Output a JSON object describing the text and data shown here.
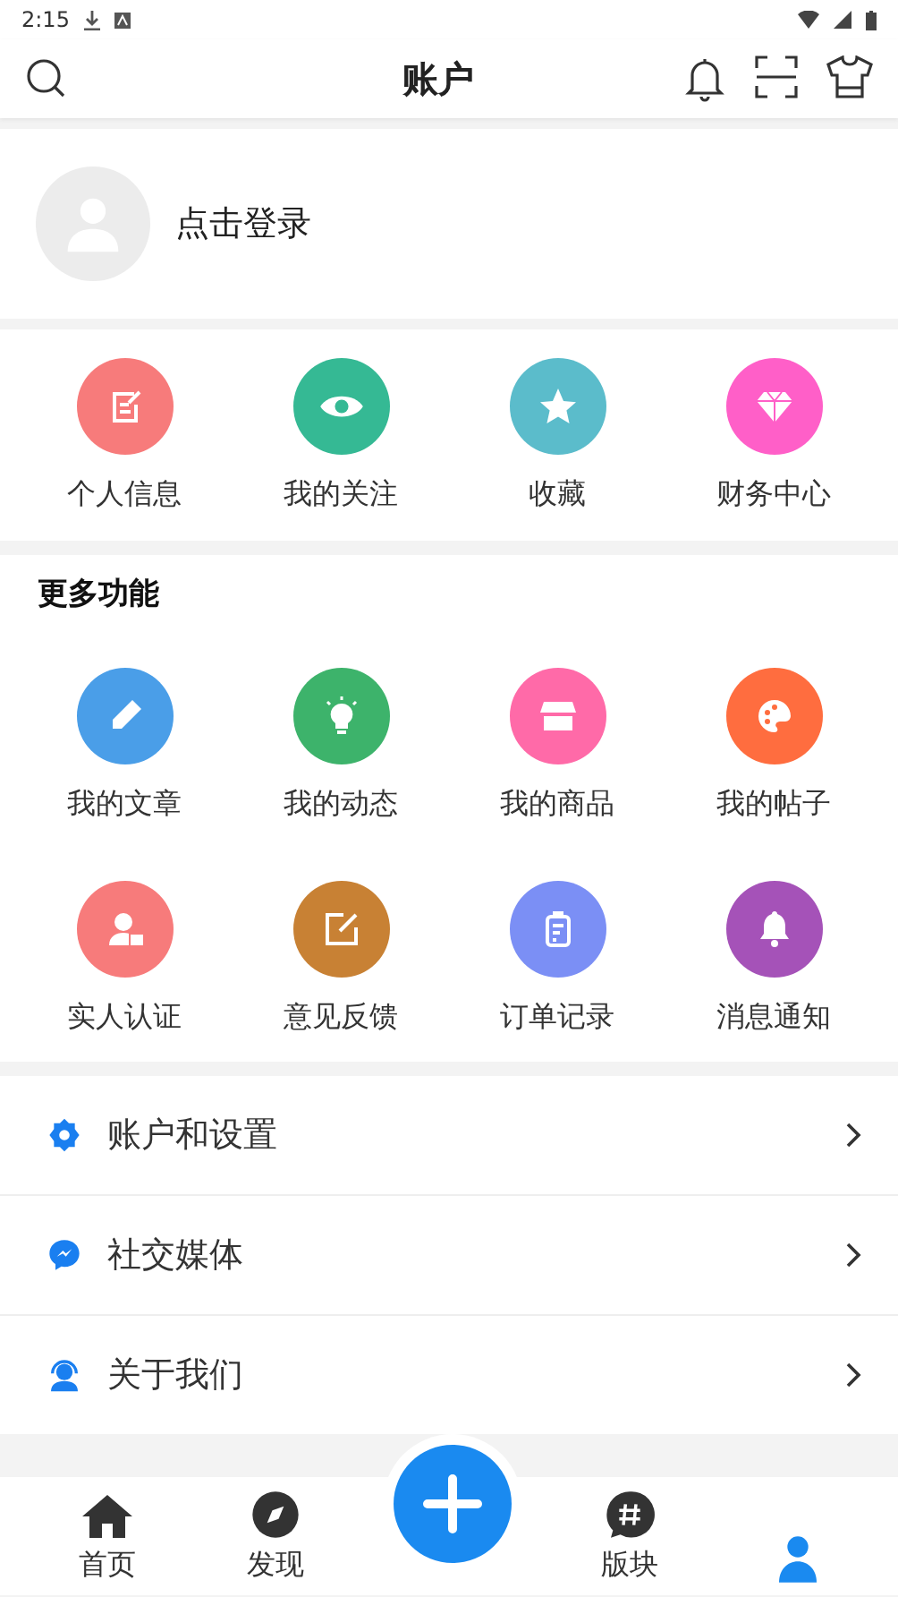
{
  "status_bar": {
    "time": "2:15"
  },
  "header": {
    "title": "账户"
  },
  "login": {
    "label": "点击登录"
  },
  "shortcuts": [
    {
      "label": "个人信息",
      "color": "#f77b7b",
      "kind": "note"
    },
    {
      "label": "我的关注",
      "color": "#35b994",
      "kind": "eye"
    },
    {
      "label": "收藏",
      "color": "#5bbccb",
      "kind": "star"
    },
    {
      "label": "财务中心",
      "color": "#ff5fc8",
      "kind": "diamond"
    }
  ],
  "more": {
    "title": "更多功能",
    "items": [
      {
        "label": "我的文章",
        "color": "#4a9ee8",
        "kind": "pencil"
      },
      {
        "label": "我的动态",
        "color": "#3db36b",
        "kind": "bulb"
      },
      {
        "label": "我的商品",
        "color": "#ff6aa8",
        "kind": "shop"
      },
      {
        "label": "我的帖子",
        "color": "#ff6d3f",
        "kind": "palette"
      },
      {
        "label": "实人认证",
        "color": "#f77b7b",
        "kind": "person"
      },
      {
        "label": "意见反馈",
        "color": "#c88134",
        "kind": "edit"
      },
      {
        "label": "订单记录",
        "color": "#7b8ff5",
        "kind": "clipboard"
      },
      {
        "label": "消息通知",
        "color": "#a552b8",
        "kind": "bell"
      }
    ]
  },
  "menu": [
    {
      "label": "账户和设置",
      "kind": "gear"
    },
    {
      "label": "社交媒体",
      "kind": "chat"
    },
    {
      "label": "关于我们",
      "kind": "support"
    }
  ],
  "tabs": [
    {
      "kind": "home",
      "label": "首页",
      "selected": false
    },
    {
      "kind": "compass",
      "label": "发现",
      "selected": false
    },
    {
      "kind": "add"
    },
    {
      "kind": "hash",
      "label": "版块",
      "selected": false
    },
    {
      "kind": "user",
      "selected": true
    }
  ]
}
